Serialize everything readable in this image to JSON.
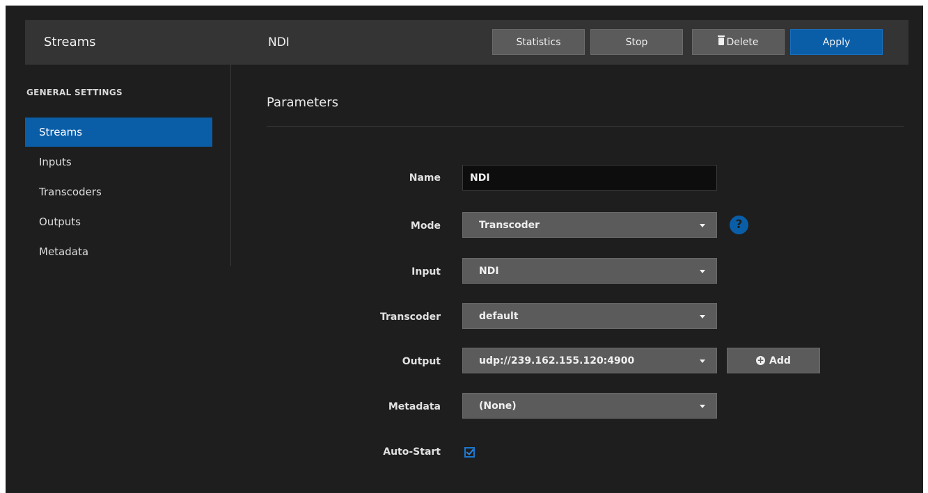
{
  "header": {
    "app_title": "Streams",
    "stream_title": "NDI",
    "buttons": {
      "statistics": "Statistics",
      "stop": "Stop",
      "delete": "Delete",
      "apply": "Apply"
    }
  },
  "sidebar": {
    "section_title": "GENERAL SETTINGS",
    "items": [
      {
        "label": "Streams",
        "active": true
      },
      {
        "label": "Inputs",
        "active": false
      },
      {
        "label": "Transcoders",
        "active": false
      },
      {
        "label": "Outputs",
        "active": false
      },
      {
        "label": "Metadata",
        "active": false
      }
    ]
  },
  "main": {
    "heading": "Parameters",
    "fields": {
      "name": {
        "label": "Name",
        "value": "NDI"
      },
      "mode": {
        "label": "Mode",
        "value": "Transcoder"
      },
      "input": {
        "label": "Input",
        "value": "NDI"
      },
      "transcoder": {
        "label": "Transcoder",
        "value": "default"
      },
      "output": {
        "label": "Output",
        "value": "udp://239.162.155.120:4900"
      },
      "metadata": {
        "label": "Metadata",
        "value": "(None)"
      },
      "auto_start": {
        "label": "Auto-Start",
        "checked": true
      }
    },
    "help_symbol": "?",
    "add_button": "Add"
  },
  "colors": {
    "accent": "#0a5ea8",
    "background": "#1e1e1e",
    "header": "#343434",
    "control": "#5b5b5b"
  },
  "icons": [
    "trash-icon",
    "help-icon",
    "plus-circle-icon",
    "chevron-down-icon",
    "checkmark-icon"
  ]
}
